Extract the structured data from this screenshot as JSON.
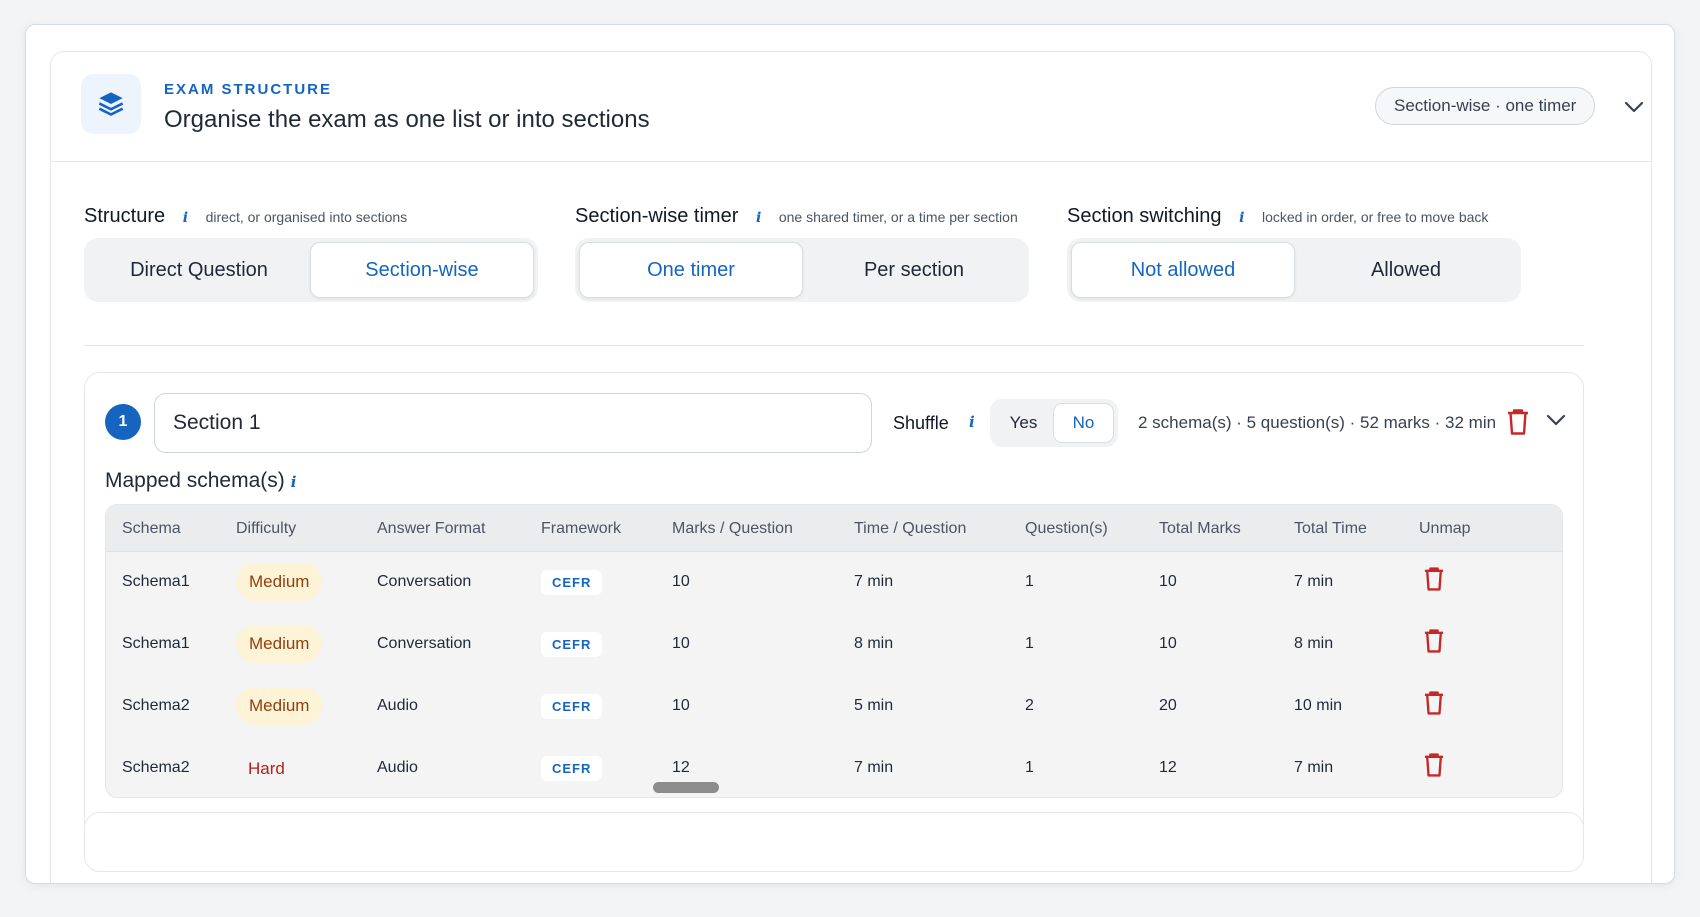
{
  "header": {
    "eyebrow": "EXAM STRUCTURE",
    "title": "Organise the exam as one list or into sections",
    "summary_pill": "Section-wise · one timer",
    "icon": "layers-icon"
  },
  "settings": {
    "structure": {
      "label": "Structure",
      "info": "i",
      "hint": "direct, or organised into sections",
      "options": [
        "Direct Question",
        "Section-wise"
      ],
      "selected": "Section-wise"
    },
    "timer": {
      "label": "Section-wise timer",
      "info": "i",
      "hint": "one shared timer, or a time per section",
      "options": [
        "One timer",
        "Per section"
      ],
      "selected": "One timer"
    },
    "switching": {
      "label": "Section switching",
      "info": "i",
      "hint": "locked in order, or free to move back",
      "options": [
        "Not allowed",
        "Allowed"
      ],
      "selected": "Not allowed"
    }
  },
  "section": {
    "number": "1",
    "name": "Section 1",
    "shuffle_label": "Shuffle",
    "shuffle_info": "i",
    "shuffle_options": [
      "Yes",
      "No"
    ],
    "shuffle_selected": "No",
    "summary": "2 schema(s) · 5 question(s) · 52 marks · 32 min",
    "mapped_title": "Mapped schema(s)",
    "mapped_info": "i",
    "columns": [
      "Schema",
      "Difficulty",
      "Answer Format",
      "Framework",
      "Marks / Question",
      "Time / Question",
      "Question(s)",
      "Total Marks",
      "Total Time",
      "Unmap"
    ],
    "rows": [
      {
        "schema": "Schema1",
        "difficulty": "Medium",
        "format": "Conversation",
        "framework": "CEFR",
        "marks": "10",
        "time": "7 min",
        "questions": "1",
        "total_marks": "10",
        "total_time": "7 min"
      },
      {
        "schema": "Schema1",
        "difficulty": "Medium",
        "format": "Conversation",
        "framework": "CEFR",
        "marks": "10",
        "time": "8 min",
        "questions": "1",
        "total_marks": "10",
        "total_time": "8 min"
      },
      {
        "schema": "Schema2",
        "difficulty": "Medium",
        "format": "Audio",
        "framework": "CEFR",
        "marks": "10",
        "time": "5 min",
        "questions": "2",
        "total_marks": "20",
        "total_time": "10 min"
      },
      {
        "schema": "Schema2",
        "difficulty": "Hard",
        "format": "Audio",
        "framework": "CEFR",
        "marks": "12",
        "time": "7 min",
        "questions": "1",
        "total_marks": "12",
        "total_time": "7 min"
      }
    ]
  },
  "colors": {
    "accent": "#1565c0",
    "medium_badge_bg": "#fdf3d6",
    "hard_text": "#b91c1c",
    "delete": "#c62828"
  }
}
